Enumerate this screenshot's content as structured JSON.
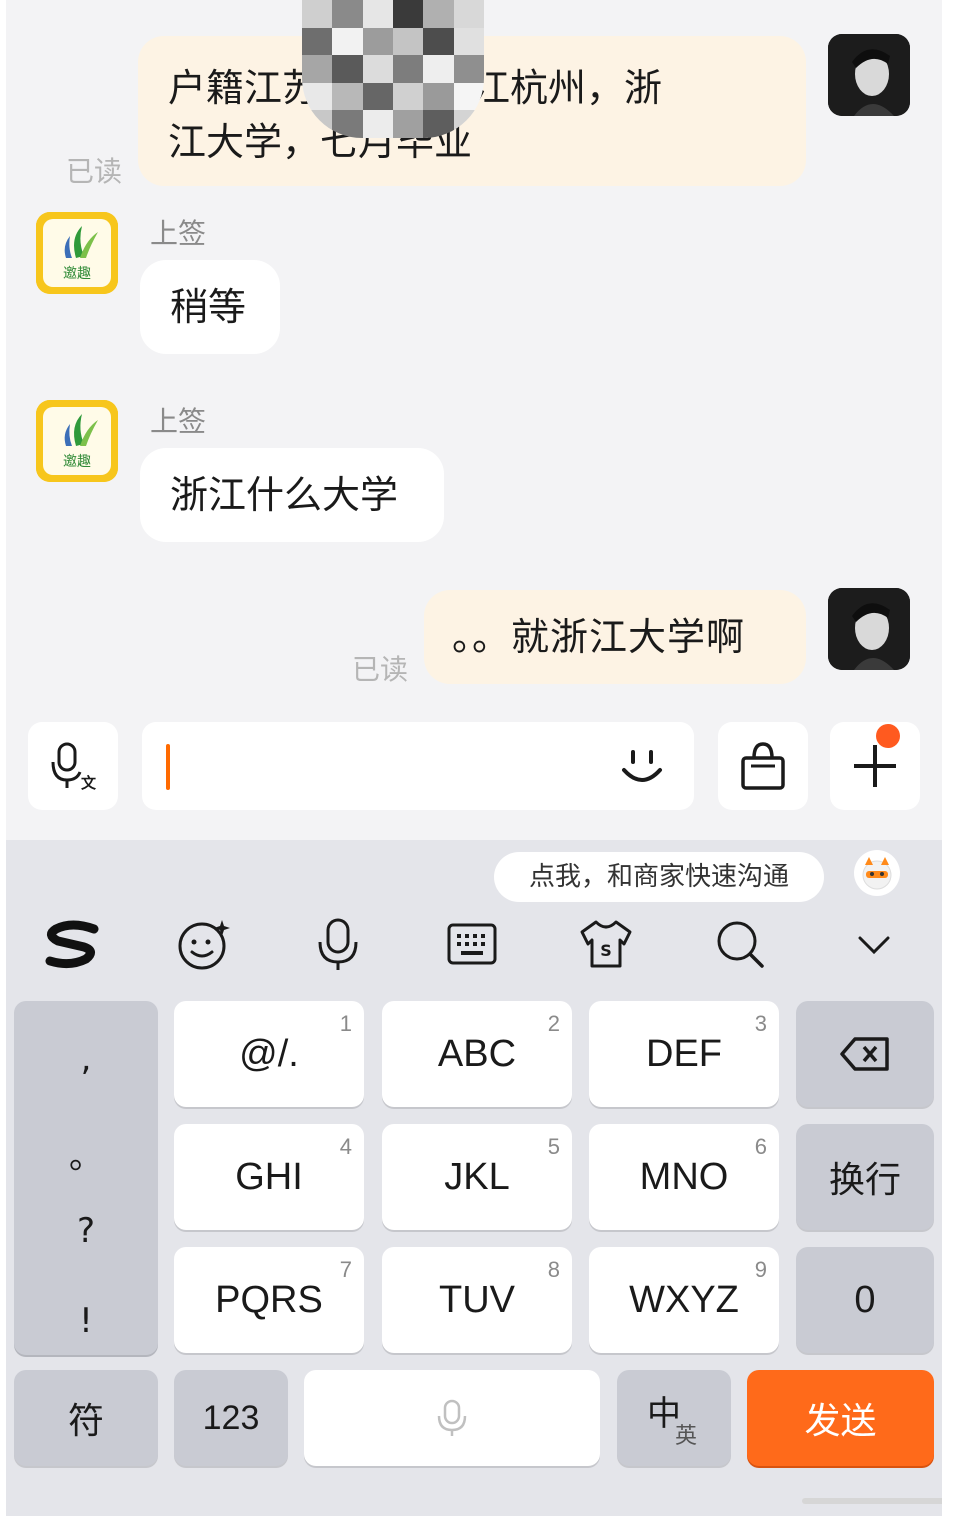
{
  "messages": [
    {
      "side": "out",
      "text_line1": "户籍江苏，常住浙江杭州，浙",
      "text_line2": "江大学，七月毕业",
      "status": "已读"
    },
    {
      "side": "in",
      "sender": "上签",
      "text": "稍等"
    },
    {
      "side": "in",
      "sender": "上签",
      "text": "浙江什么大学"
    },
    {
      "side": "out",
      "text": "。。就浙江大学啊",
      "status": "已读"
    }
  ],
  "shop_logo_text": "邀趣",
  "input": {
    "value": "",
    "voice_icon": "voice-to-text-icon",
    "emoji_icon": "smiley-icon",
    "bag_icon": "shopping-bag-icon",
    "plus_icon": "plus-icon",
    "badge_color": "#ff5a1f"
  },
  "keyboard": {
    "tip": "点我，和商家快速沟通",
    "toolbar_icons": [
      "sogou-logo-icon",
      "emoji-face-icon",
      "microphone-icon",
      "keyboard-icon",
      "skin-shirt-icon",
      "search-icon",
      "collapse-chevron-icon"
    ],
    "punct": [
      ",",
      "。",
      "?",
      "!"
    ],
    "keys": [
      {
        "label": "@/.",
        "num": "1"
      },
      {
        "label": "ABC",
        "num": "2"
      },
      {
        "label": "DEF",
        "num": "3"
      },
      {
        "label": "GHI",
        "num": "4"
      },
      {
        "label": "JKL",
        "num": "5"
      },
      {
        "label": "MNO",
        "num": "6"
      },
      {
        "label": "PQRS",
        "num": "7"
      },
      {
        "label": "TUV",
        "num": "8"
      },
      {
        "label": "WXYZ",
        "num": "9"
      }
    ],
    "newline": "换行",
    "zero": "0",
    "symbols": "符",
    "numeric": "123",
    "lang_main": "中",
    "lang_sub": "英",
    "send": "发送"
  },
  "colors": {
    "accent": "#ff6a1a",
    "out_bubble": "#fdf3e4",
    "shop_logo": "#f7c61c"
  }
}
